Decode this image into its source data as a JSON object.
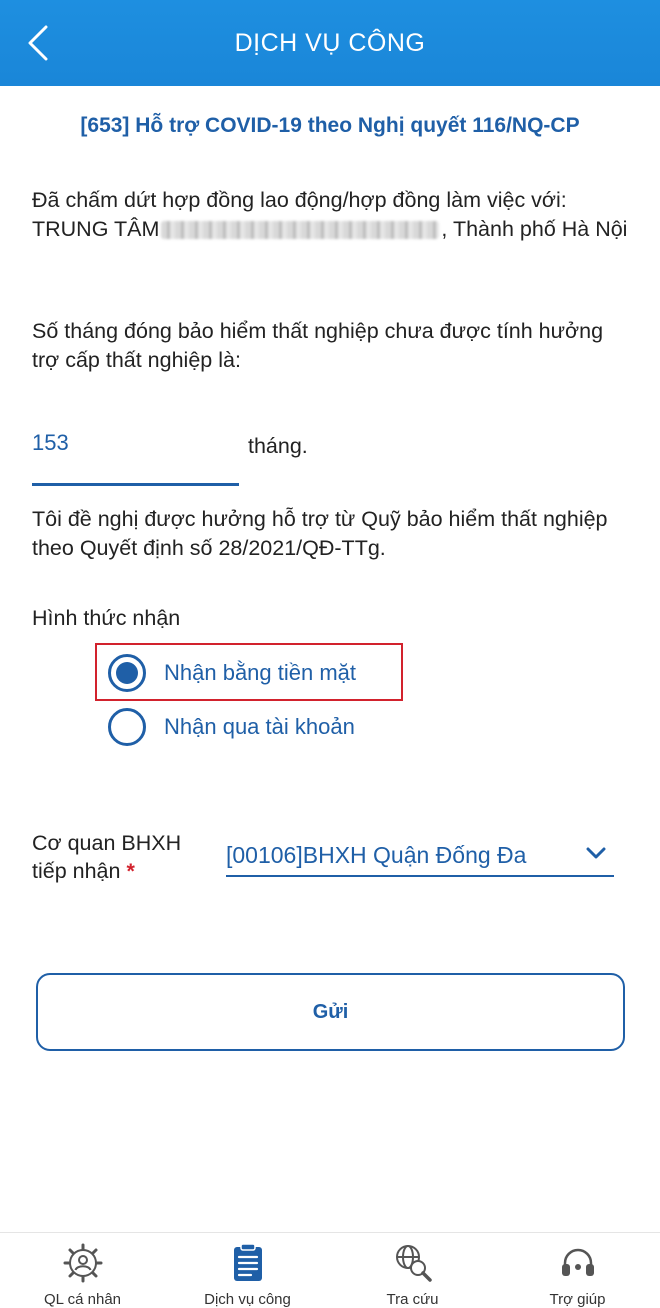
{
  "header": {
    "title": "DỊCH VỤ CÔNG"
  },
  "service": {
    "title": "[653] Hỗ trợ COVID-19 theo Nghị quyết 116/NQ-CP"
  },
  "content": {
    "terminated_prefix": "Đã chấm dứt hợp đồng  lao động/hợp đồng làm việc với: TRUNG TÂM",
    "terminated_suffix": ", Thành phố Hà Nội",
    "months_question": "Số tháng đóng bảo hiểm thất nghiệp chưa được tính hưởng trợ cấp thất nghiệp là:",
    "months_value": "153",
    "months_unit": "tháng.",
    "request_text": "Tôi đề nghị được hưởng hỗ trợ từ Quỹ bảo hiểm thất nghiệp theo Quyết định số 28/2021/QĐ-TTg."
  },
  "receive_method": {
    "label": "Hình thức nhận",
    "options": [
      {
        "label": "Nhận bằng tiền mặt",
        "selected": true
      },
      {
        "label": "Nhận qua tài khoản",
        "selected": false
      }
    ]
  },
  "agency": {
    "label": "Cơ quan BHXH tiếp nhận",
    "required_mark": "*",
    "selected": "[00106]BHXH Quận Đống Đa"
  },
  "submit": {
    "label": "Gửi"
  },
  "bottom_nav": [
    {
      "label": "QL cá nhân",
      "icon": "gear-user-icon"
    },
    {
      "label": "Dịch vụ công",
      "icon": "document-icon"
    },
    {
      "label": "Tra cứu",
      "icon": "globe-search-icon"
    },
    {
      "label": "Trợ giúp",
      "icon": "headset-icon"
    }
  ],
  "colors": {
    "header_blue": "#1a86d8",
    "primary_blue": "#1f5fa7",
    "highlight_red": "#d2222d"
  }
}
